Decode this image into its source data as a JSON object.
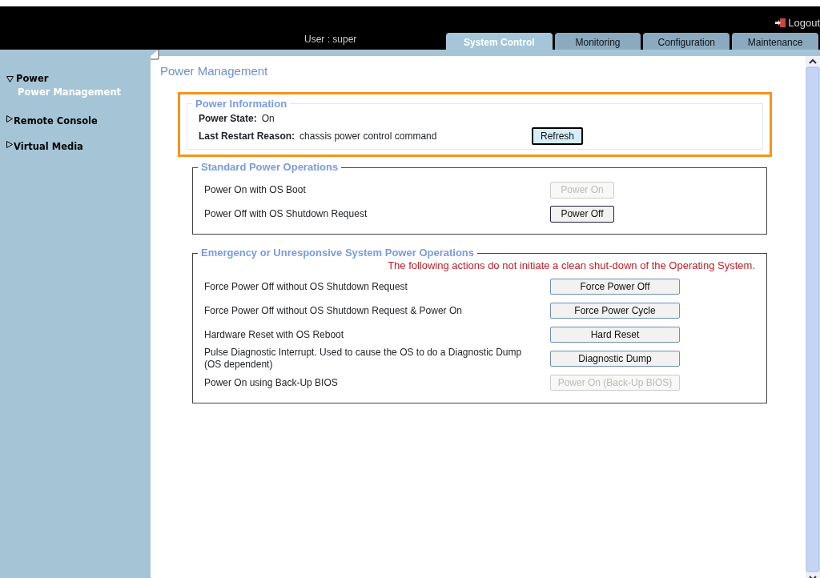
{
  "header": {
    "logout": "Logout",
    "user_label": "User :",
    "user": "super"
  },
  "tabs": [
    {
      "label": "System Control",
      "selected": true
    },
    {
      "label": "Monitoring",
      "selected": false
    },
    {
      "label": "Configuration",
      "selected": false
    },
    {
      "label": "Maintenance",
      "selected": false
    }
  ],
  "sidebar": {
    "items": [
      {
        "label": "Power",
        "expanded": true,
        "children": [
          {
            "label": "Power Management",
            "selected": true
          }
        ]
      },
      {
        "label": "Remote Console",
        "expanded": false
      },
      {
        "label": "Virtual Media",
        "expanded": false
      }
    ]
  },
  "page_title": "Power Management",
  "power_information": {
    "title": "Power Information",
    "highlighted": true,
    "fields": [
      {
        "label": "Power State:",
        "value": "On"
      },
      {
        "label": "Last Restart Reason:",
        "value": "chassis power control command"
      }
    ],
    "button": {
      "label": "Refresh",
      "disabled": false
    }
  },
  "sections": [
    {
      "title": "Standard Power Operations",
      "rows": [
        {
          "label": "Power On with OS Boot",
          "button": "Power On",
          "disabled": true
        },
        {
          "label": "Power Off with OS Shutdown Request",
          "button": "Power Off",
          "disabled": false
        }
      ]
    },
    {
      "title": "Emergency or Unresponsive System Power Operations",
      "warning": "The following actions do not initiate a clean shut-down of the Operating System.",
      "rows": [
        {
          "label": "Force Power Off without OS Shutdown Request",
          "button": "Force Power Off",
          "disabled": false
        },
        {
          "label": "Force Power Off without OS Shutdown Request & Power On",
          "button": "Force Power Cycle",
          "disabled": false
        },
        {
          "label": "Hardware Reset with OS Reboot",
          "button": "Hard Reset",
          "disabled": false
        },
        {
          "label": "Pulse Diagnostic Interrupt. Used to cause the OS to do a Diagnostic Dump (OS dependent)",
          "button": "Diagnostic Dump",
          "disabled": false
        },
        {
          "label": "Power On using Back-Up BIOS",
          "button": "Power On (Back-Up BIOS)",
          "disabled": true
        }
      ]
    }
  ]
}
